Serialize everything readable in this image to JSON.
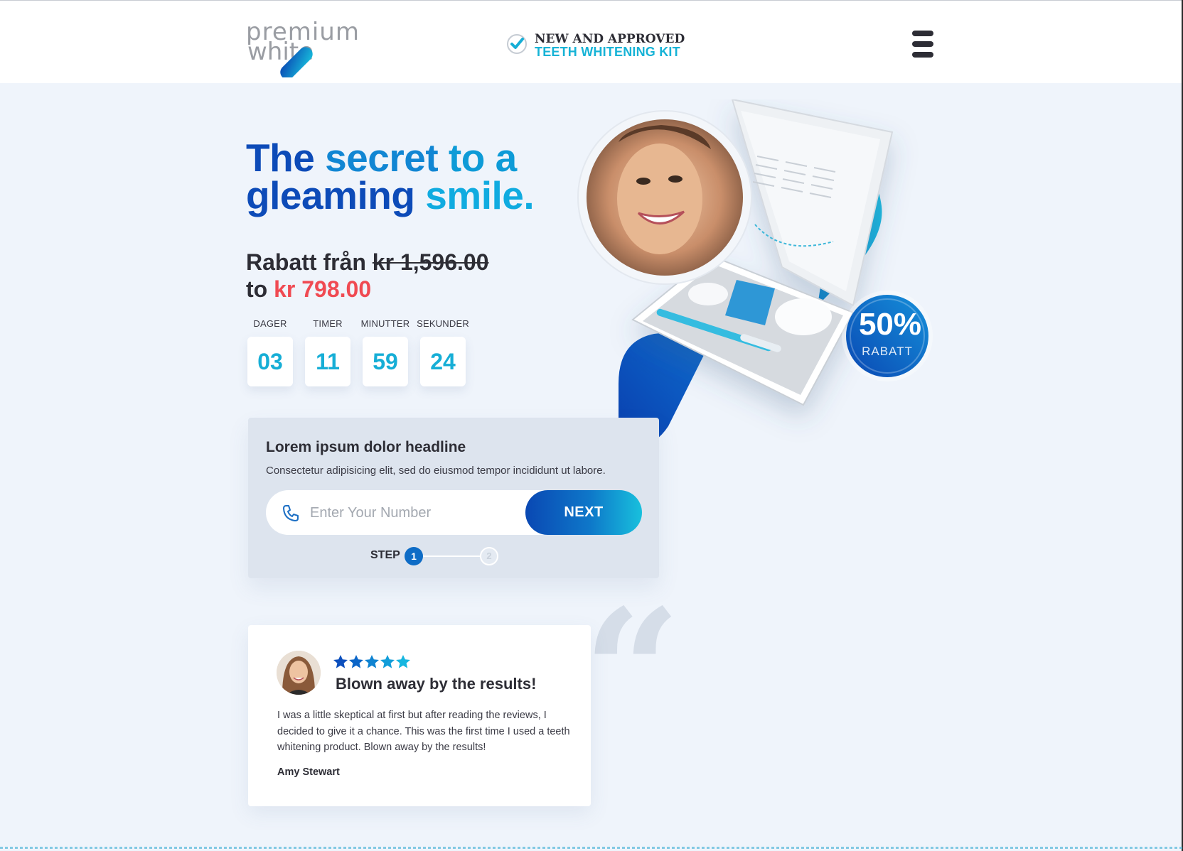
{
  "header": {
    "logo": {
      "line1": "premium",
      "line2": "white"
    },
    "approved_line1": "NEW AND APPROVED",
    "approved_line2": "TEETH WHITENING KIT"
  },
  "hero": {
    "headline_part1": "The ",
    "headline_part2": "secret ",
    "headline_part3": "to a",
    "headline_part4": "gleaming ",
    "headline_part5": "smile."
  },
  "price": {
    "prefix": "Rabatt från ",
    "old_price": "kr 1,596.00",
    "connector": "to ",
    "new_price": "kr 798.00"
  },
  "countdown": [
    {
      "label": "DAGER",
      "value": "03"
    },
    {
      "label": "TIMER",
      "value": "11"
    },
    {
      "label": "MINUTTER",
      "value": "59"
    },
    {
      "label": "SEKUNDER",
      "value": "24"
    }
  ],
  "discount_badge": {
    "percent": "50%",
    "label": "RABATT"
  },
  "form": {
    "headline": "Lorem ipsum dolor headline",
    "subtext": "Consectetur adipisicing elit, sed do eiusmod tempor incididunt ut labore.",
    "phone_placeholder": "Enter Your Number",
    "phone_value": "",
    "next_label": "NEXT",
    "step_label": "STEP",
    "step_1": "1",
    "step_2": "2"
  },
  "review": {
    "rating": 5,
    "title": "Blown away by the results!",
    "body": "I was a little skeptical at first but after reading the reviews, I decided to give it a chance. This was the first time I used a teeth whitening product. Blown away by the results!",
    "author": "Amy Stewart"
  },
  "colors": {
    "brand_dark_blue": "#0d4bb8",
    "brand_cyan": "#16aed6",
    "price_red": "#f04a52",
    "page_bg": "#eff4fb"
  }
}
